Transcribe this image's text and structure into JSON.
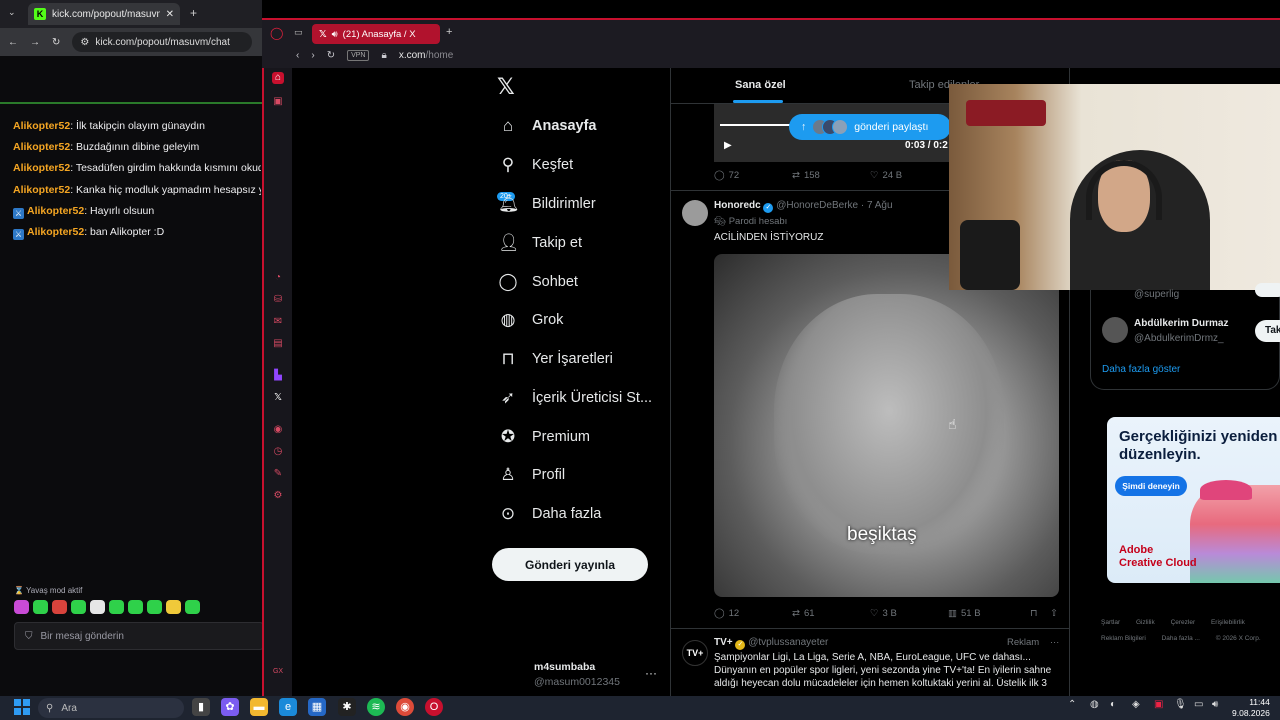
{
  "left_browser": {
    "tab_title": "kick.com/popout/masuvm/chat",
    "url": "kick.com/popout/masuvm/chat",
    "chat": [
      {
        "user": "Alikopter52",
        "msg": ": İlk takipçin olayım günaydın",
        "badge": false
      },
      {
        "user": "Alikopter52",
        "msg": ": Buzdağının dibine geleyim",
        "badge": false
      },
      {
        "user": "Alikopter52",
        "msg": ": Tesadüfen girdim hakkında kısmını okudum",
        "badge": false
      },
      {
        "user": "Alikopter52",
        "msg": ": Kanka hiç modluk yapmadım hesapsız yapı",
        "badge": false
      },
      {
        "user": "Alikopter52",
        "msg": ": Hayırlı olsuun",
        "badge": true
      },
      {
        "user": "Alikopter52",
        "msg": ": ban Alikopter :D",
        "badge": true
      }
    ],
    "slow_mode": "Yavaş mod aktif",
    "input_placeholder": "Bir mesaj gönderin"
  },
  "opera": {
    "tab_title": "(21) Anasayfa / X",
    "url_host": "x.com",
    "url_path": "/home",
    "vpn": "VPN"
  },
  "x_nav": {
    "logo": "𝕏",
    "items": [
      {
        "label": "Anasayfa",
        "icon": "home-icon"
      },
      {
        "label": "Keşfet",
        "icon": "search-icon"
      },
      {
        "label": "Bildirimler",
        "icon": "bell-icon"
      },
      {
        "label": "Takip et",
        "icon": "follow-icon"
      },
      {
        "label": "Sohbet",
        "icon": "chat-icon"
      },
      {
        "label": "Grok",
        "icon": "grok-icon"
      },
      {
        "label": "Yer İşaretleri",
        "icon": "bookmark-icon"
      },
      {
        "label": "İçerik Üreticisi St...",
        "icon": "rocket-icon"
      },
      {
        "label": "Premium",
        "icon": "premium-icon"
      },
      {
        "label": "Profil",
        "icon": "profile-icon"
      },
      {
        "label": "Daha fazla",
        "icon": "more-icon"
      }
    ],
    "notif_badge": "20+",
    "post_button": "Gönderi yayınla",
    "profile_name": "m4sumbaba",
    "profile_handle": "@masum0012345"
  },
  "timeline": {
    "tabs": [
      "Sana özel",
      "Takip edilenler"
    ],
    "shared_pill": "gönderi paylaştı",
    "video_time": "0:03 / 0:2",
    "top_actions": {
      "replies": "72",
      "reposts": "158",
      "likes": "24 B"
    },
    "tweet": {
      "name": "Honoredc",
      "handle": "@HonoreDeBerke · 7 Ağu",
      "parody": "Parodi hesabı",
      "text": "ACİLİNDEN İSTİYORUZ",
      "caption": "beşiktaş",
      "replies": "12",
      "reposts": "61",
      "likes": "3 B",
      "views": "51 B"
    },
    "ad": {
      "avatar": "TV+",
      "name": "TV+",
      "handle": "@tvplussanayeter",
      "tag": "Reklam",
      "body": "Şampiyonlar Ligi, La Liga, Serie A, NBA, EuroLeague, UFC ve dahası... Dünyanın en popüler spor ligleri, yeni sezonda yine TV+'ta! En iyilerin sahne aldığı heyecan dolu mücadeleler için hemen koltuktaki yerini al. Üstelik ilk 3"
    }
  },
  "right": {
    "wf1_handle": "@superlig",
    "wf2_name": "Abdülkerim Durmaz",
    "wf2_handle": "@AbdulkerimDrmz_",
    "wf2_btn": "Tak",
    "show_more": "Daha fazla göster",
    "ad_title": "Gerçekliğinizi yeniden düzenleyin.",
    "ad_cta": "Şimdi deneyin",
    "ad_brand": "Adobe Creative Cloud",
    "footer": [
      "Şartlar",
      "Gizlilik",
      "Çerezler",
      "Erişilebilirlik",
      "Reklam Bilgileri",
      "Daha fazla ...",
      "© 2026 X Corp."
    ]
  },
  "taskbar": {
    "search_placeholder": "Ara",
    "time": "11:44",
    "date": "9.08.2026"
  },
  "colors": {
    "x_blue": "#1d9bf0",
    "opera_red": "#c8102e",
    "kick_green": "#53fc18",
    "chat_user": "#f5a623"
  }
}
